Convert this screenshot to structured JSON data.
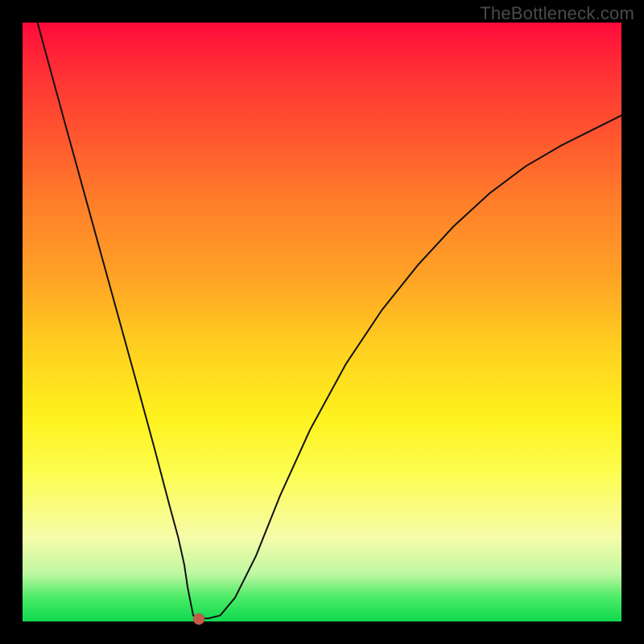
{
  "watermark": "TheBottleneck.com",
  "chart_data": {
    "type": "line",
    "title": "",
    "xlabel": "",
    "ylabel": "",
    "xlim": [
      0,
      1
    ],
    "ylim": [
      0,
      1
    ],
    "grid": false,
    "legend": false,
    "marker": {
      "x": 0.295,
      "y": 0.0
    },
    "series": [
      {
        "name": "curve",
        "x": [
          0.025,
          0.07,
          0.11,
          0.15,
          0.19,
          0.22,
          0.245,
          0.26,
          0.27,
          0.276,
          0.282,
          0.285,
          0.295,
          0.31,
          0.33,
          0.355,
          0.39,
          0.43,
          0.48,
          0.54,
          0.6,
          0.66,
          0.72,
          0.78,
          0.84,
          0.9,
          0.95,
          1.0
        ],
        "y": [
          1.0,
          0.835,
          0.69,
          0.545,
          0.4,
          0.29,
          0.195,
          0.14,
          0.095,
          0.055,
          0.025,
          0.01,
          0.005,
          0.005,
          0.01,
          0.04,
          0.11,
          0.21,
          0.32,
          0.43,
          0.52,
          0.595,
          0.66,
          0.715,
          0.76,
          0.795,
          0.82,
          0.845
        ]
      }
    ]
  }
}
